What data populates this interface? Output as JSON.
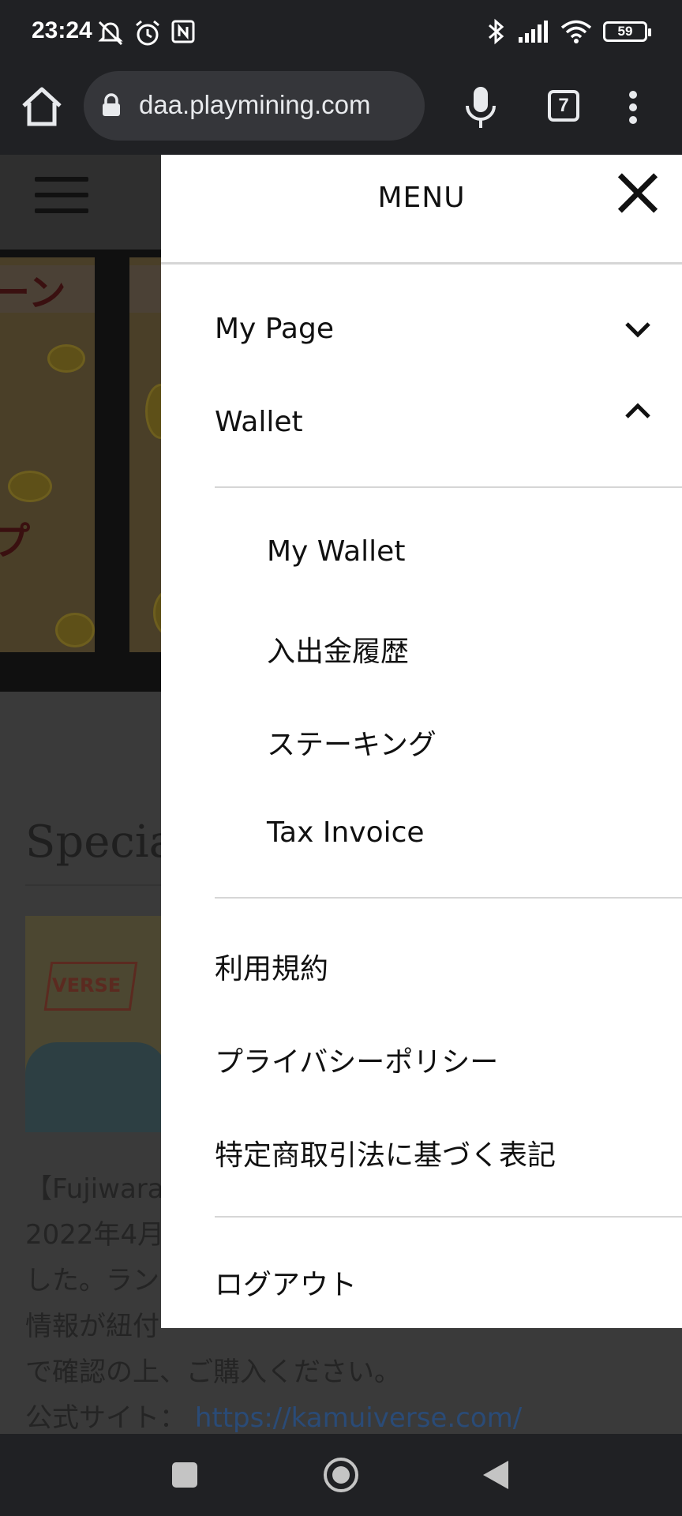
{
  "status_bar": {
    "time": "23:24",
    "battery": "59"
  },
  "browser": {
    "url": "daa.playmining.com",
    "tab_count": "7"
  },
  "menu": {
    "title": "MENU",
    "items": {
      "my_page": "My Page",
      "wallet": "Wallet",
      "terms": "利用規約",
      "privacy": "プライバシーポリシー",
      "tokushoho": "特定商取引法に基づく表記",
      "logout": "ログアウト"
    },
    "wallet_submenu": [
      "My Wallet",
      "入出金履歴",
      "ステーキング",
      "Tax Invoice"
    ]
  },
  "background_page": {
    "section_title": "Special",
    "paragraph_lines": [
      "【Fujiwara",
      "2022年4月",
      "した。ラン",
      "情報が紐付",
      "で確認の上、ご購入ください。"
    ],
    "official_site_label": "公式サイト：",
    "official_site_link": "https://kamuiverse.com/",
    "logo_text": "VERSE"
  }
}
